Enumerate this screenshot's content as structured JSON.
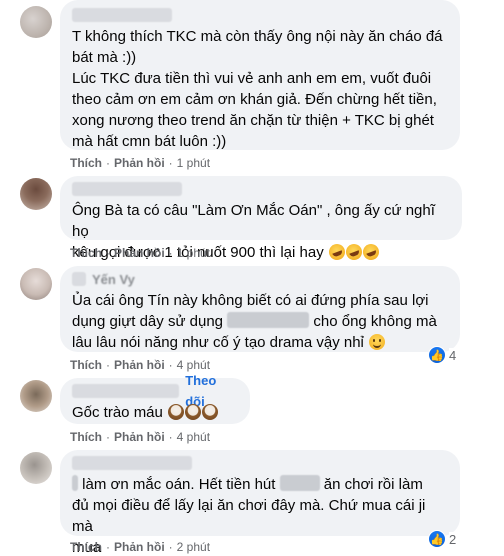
{
  "actions": {
    "like": "Thích",
    "reply": "Phản hồi",
    "sep": "·"
  },
  "comments": [
    {
      "lines": [
        "T không thích TKC mà còn thấy ông nội này ăn cháo đá",
        "bát mà :))",
        "Lúc TKC đưa tiền thì vui vẻ anh anh em em, vuốt đuôi",
        "theo cảm ơn em cảm ơn khán giả. Đến chừng hết tiền,",
        "xong nương theo trend ăn chặn từ thiện + TKC bị ghét",
        "mà hất cmn bát luôn :))"
      ],
      "time": "1 phút"
    },
    {
      "lines": [
        "Ông Bà ta có câu \"Làm Ơn Mắc Oán\" , ông ấy cứ nghĩ họ",
        "kêu gọi được 1 tỏi nuốt 900 thì lại hay"
      ],
      "time": "1 phút"
    },
    {
      "name_partial": "Yến Vy",
      "lines": [
        "Ủa cái ông Tín này không biết có ai đứng phía sau lợi",
        "dụng giựt dây sử dụng",
        "cho ổng không mà",
        "lâu lâu nói năng như cố ý tạo drama vậy nhỉ"
      ],
      "time": "4 phút",
      "reaction_count": "4"
    },
    {
      "follow": "Theo dõi",
      "lines": [
        "Gốc trào máu"
      ],
      "time": "4 phút"
    },
    {
      "lines": [
        "làm ơn mắc oán. Hết tiền hút",
        "ăn chơi rồi làm",
        "đủ mọi điều để lấy lại ăn chơi đây mà. Chứ mua cái ji mà",
        "mua"
      ],
      "time": "2 phút",
      "reaction_count": "2"
    }
  ],
  "colors": {
    "bubble": "#f0f2f5",
    "meta": "#65676b",
    "link": "#216fdb",
    "like": "#1877f2"
  }
}
